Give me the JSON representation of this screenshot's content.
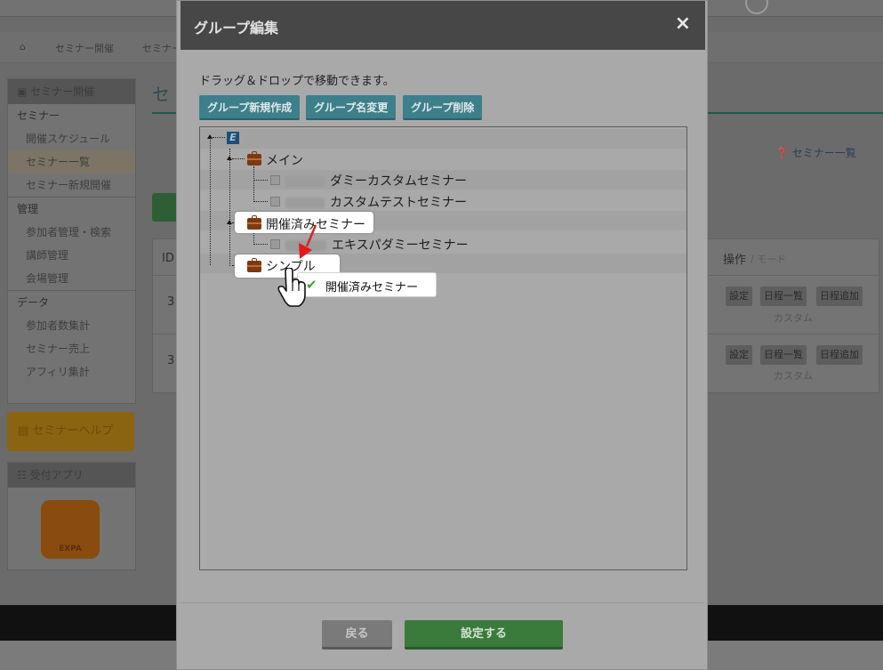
{
  "background": {
    "breadcrumb": [
      "セミナー開催",
      "セミナー"
    ],
    "sidebar": {
      "header": "セミナー開催",
      "sections": [
        {
          "title": "セミナー",
          "items": [
            "開催スケジュール",
            "セミナー一覧",
            "セミナー新規開催"
          ],
          "selected": "セミナー一覧"
        },
        {
          "title": "管理",
          "items": [
            "参加者管理・検索",
            "講師管理",
            "会場管理"
          ]
        },
        {
          "title": "データ",
          "items": [
            "参加者数集計",
            "セミナー売上",
            "アフィリ集計"
          ]
        }
      ]
    },
    "help_button": "セミナーヘルプ",
    "app_panel": {
      "header": "受付アプリ",
      "logo_text": "EXPA"
    },
    "page_title": "セ",
    "seminar_list_link": "セミナー一覧",
    "table": {
      "header_id": "ID",
      "header_ops": "操作",
      "header_mode": "モード",
      "rows": [
        {
          "id": "3",
          "buttons": [
            "設定",
            "日程一覧",
            "日程追加"
          ],
          "mode": "カスタム"
        },
        {
          "id": "3",
          "buttons": [
            "設定",
            "日程一覧",
            "日程追加"
          ],
          "mode": "カスタム"
        }
      ]
    }
  },
  "modal": {
    "title": "グループ編集",
    "close_icon": "×",
    "hint": "ドラッグ＆ドロップで移動できます。",
    "toolbar": {
      "create": "グループ新規作成",
      "rename": "グループ名変更",
      "delete": "グループ削除"
    },
    "tree": {
      "root_icon_letter": "E",
      "groups": [
        {
          "label": "メイン",
          "children": [
            "ダミーカスタムセミナー",
            "カスタムテストセミナー"
          ]
        },
        {
          "label": "開催済みセミナー",
          "children": [
            "エキスパダミーセミナー"
          ]
        },
        {
          "label": "シンプル",
          "children": []
        }
      ]
    },
    "drag_tooltip": {
      "label": "開催済みセミナー",
      "icon": "check-icon"
    },
    "footer": {
      "back": "戻る",
      "submit": "設定する"
    }
  }
}
